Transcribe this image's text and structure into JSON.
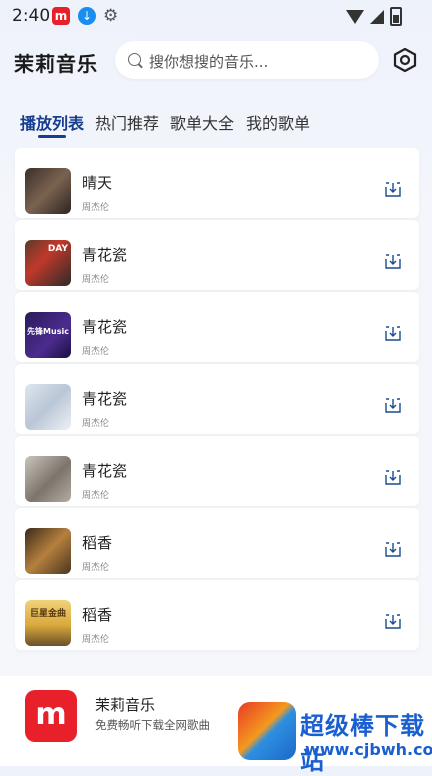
{
  "status_bar": {
    "time": "2:40",
    "app_badge": "m"
  },
  "header": {
    "title": "茉莉音乐",
    "search_placeholder": "搜你想搜的音乐..."
  },
  "tabs": [
    {
      "label": "播放列表",
      "active": true
    },
    {
      "label": "热门推荐",
      "active": false
    },
    {
      "label": "歌单大全",
      "active": false
    },
    {
      "label": "我的歌单",
      "active": false
    }
  ],
  "songs": [
    {
      "title": "晴天",
      "artist": "周杰伦",
      "cover_text": ""
    },
    {
      "title": "青花瓷",
      "artist": "周杰伦",
      "cover_text": "DAY"
    },
    {
      "title": "青花瓷",
      "artist": "周杰伦",
      "cover_text": "先锋Music"
    },
    {
      "title": "青花瓷",
      "artist": "周杰伦",
      "cover_text": ""
    },
    {
      "title": "青花瓷",
      "artist": "周杰伦",
      "cover_text": ""
    },
    {
      "title": "稻香",
      "artist": "周杰伦",
      "cover_text": ""
    },
    {
      "title": "稻香",
      "artist": "周杰伦",
      "cover_text": "巨星金曲"
    }
  ],
  "bottom_card": {
    "logo": "m",
    "title": "茉莉音乐",
    "subtitle": "免费畅听下载全网歌曲"
  },
  "watermark": {
    "text": "超级棒下载站",
    "url": "www.cjbwh.com"
  },
  "colors": {
    "accent": "#173d8e",
    "brand_red": "#e8202a",
    "watermark_blue": "#1a5fd0"
  }
}
